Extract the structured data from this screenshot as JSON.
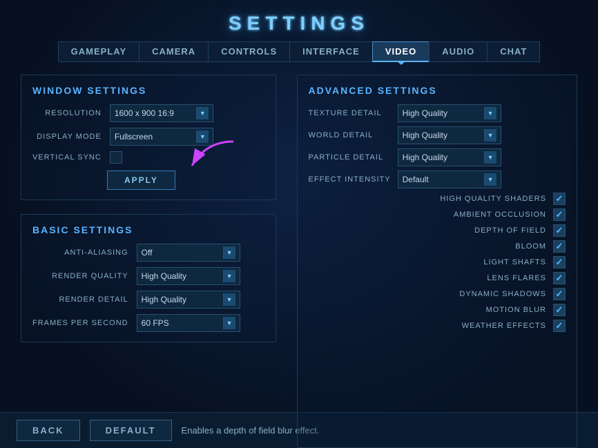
{
  "title": "SETTINGS",
  "tabs": [
    {
      "id": "gameplay",
      "label": "GAMEPLAY",
      "active": false
    },
    {
      "id": "camera",
      "label": "CAMERA",
      "active": false
    },
    {
      "id": "controls",
      "label": "CONTROLS",
      "active": false
    },
    {
      "id": "interface",
      "label": "INTERFACE",
      "active": false
    },
    {
      "id": "video",
      "label": "VIDEO",
      "active": true
    },
    {
      "id": "audio",
      "label": "AUDIO",
      "active": false
    },
    {
      "id": "chat",
      "label": "CHAT",
      "active": false
    }
  ],
  "window_settings": {
    "section_title": "WINDOW SETTINGS",
    "resolution": {
      "label": "RESOLUTION",
      "value": "1600 x 900 16:9"
    },
    "display_mode": {
      "label": "DISPLAY MODE",
      "value": "Fullscreen"
    },
    "vertical_sync": {
      "label": "VERTICAL SYNC",
      "checked": false
    },
    "apply_label": "APPLY"
  },
  "basic_settings": {
    "section_title": "BASIC SETTINGS",
    "anti_aliasing": {
      "label": "ANTI-ALIASING",
      "value": "Off"
    },
    "render_quality": {
      "label": "RENDER QUALITY",
      "value": "High Quality"
    },
    "render_detail": {
      "label": "RENDER DETAIL",
      "value": "High Quality"
    },
    "frames_per_second": {
      "label": "FRAMES PER SECOND",
      "value": "60 FPS"
    }
  },
  "advanced_settings": {
    "section_title": "ADVANCED SETTINGS",
    "texture_detail": {
      "label": "TEXTURE DETAIL",
      "value": "High Quality"
    },
    "world_detail": {
      "label": "WORLD DETAIL",
      "value": "High Quality"
    },
    "particle_detail": {
      "label": "PARTICLE DETAIL",
      "value": "High Quality"
    },
    "effect_intensity": {
      "label": "EFFECT INTENSITY",
      "value": "Default"
    },
    "checkboxes": [
      {
        "id": "hq_shaders",
        "label": "HIGH QUALITY SHADERS",
        "checked": true
      },
      {
        "id": "ambient_occlusion",
        "label": "AMBIENT OCCLUSION",
        "checked": true
      },
      {
        "id": "depth_of_field",
        "label": "DEPTH OF FIELD",
        "checked": true
      },
      {
        "id": "bloom",
        "label": "BLOOM",
        "checked": true
      },
      {
        "id": "light_shafts",
        "label": "LIGHT SHAFTS",
        "checked": true
      },
      {
        "id": "lens_flares",
        "label": "LENS FLARES",
        "checked": true
      },
      {
        "id": "dynamic_shadows",
        "label": "DYNAMIC SHADOWS",
        "checked": true
      },
      {
        "id": "motion_blur",
        "label": "MOTION BLUR",
        "checked": true
      },
      {
        "id": "weather_effects",
        "label": "WEATHER EFFECTS",
        "checked": true
      }
    ]
  },
  "bottom_bar": {
    "back_label": "BACK",
    "default_label": "DEFAULT",
    "hint_text": "Enables a depth of field blur effect."
  }
}
